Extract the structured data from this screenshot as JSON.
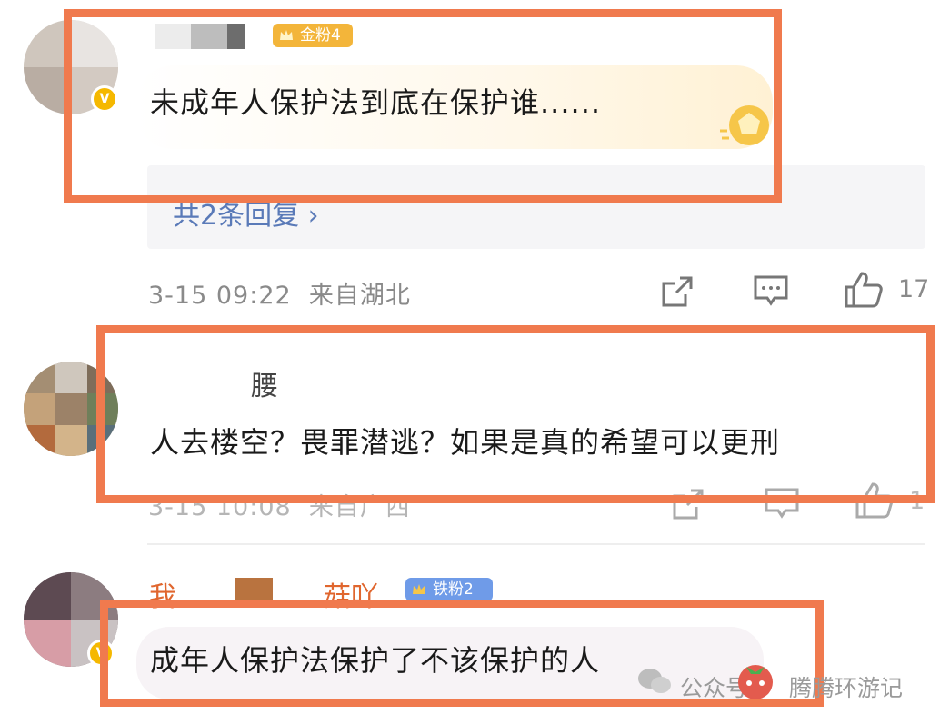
{
  "comments": [
    {
      "username": "",
      "fan_badge": "金粉4",
      "text": "未成年人保护法到底在保护谁......",
      "replies_link": "共2条回复",
      "timestamp": "3-15 09:22",
      "location": "来自湖北",
      "like_count": "17"
    },
    {
      "username": "腰",
      "text": "人去楼空？畏罪潜逃？如果是真的希望可以更刑",
      "timestamp": "3-15 10:08",
      "location": "来自广西",
      "like_count": "1"
    },
    {
      "username_start": "我",
      "username_end": "菇吖",
      "fan_badge": "铁粉2",
      "text": "成年人保护法保护了不该保护的人"
    }
  ],
  "watermark": {
    "platform": "公众号",
    "author": "腾腾环游记"
  },
  "colors": {
    "highlight_border": "#f07a4e",
    "gold_badge": "#f3b53a",
    "iron_badge": "#6f9be8",
    "reply_link": "#5a7ab8"
  },
  "icons": [
    "share-icon",
    "comment-icon",
    "like-icon",
    "vip-v-icon",
    "crown-icon"
  ]
}
